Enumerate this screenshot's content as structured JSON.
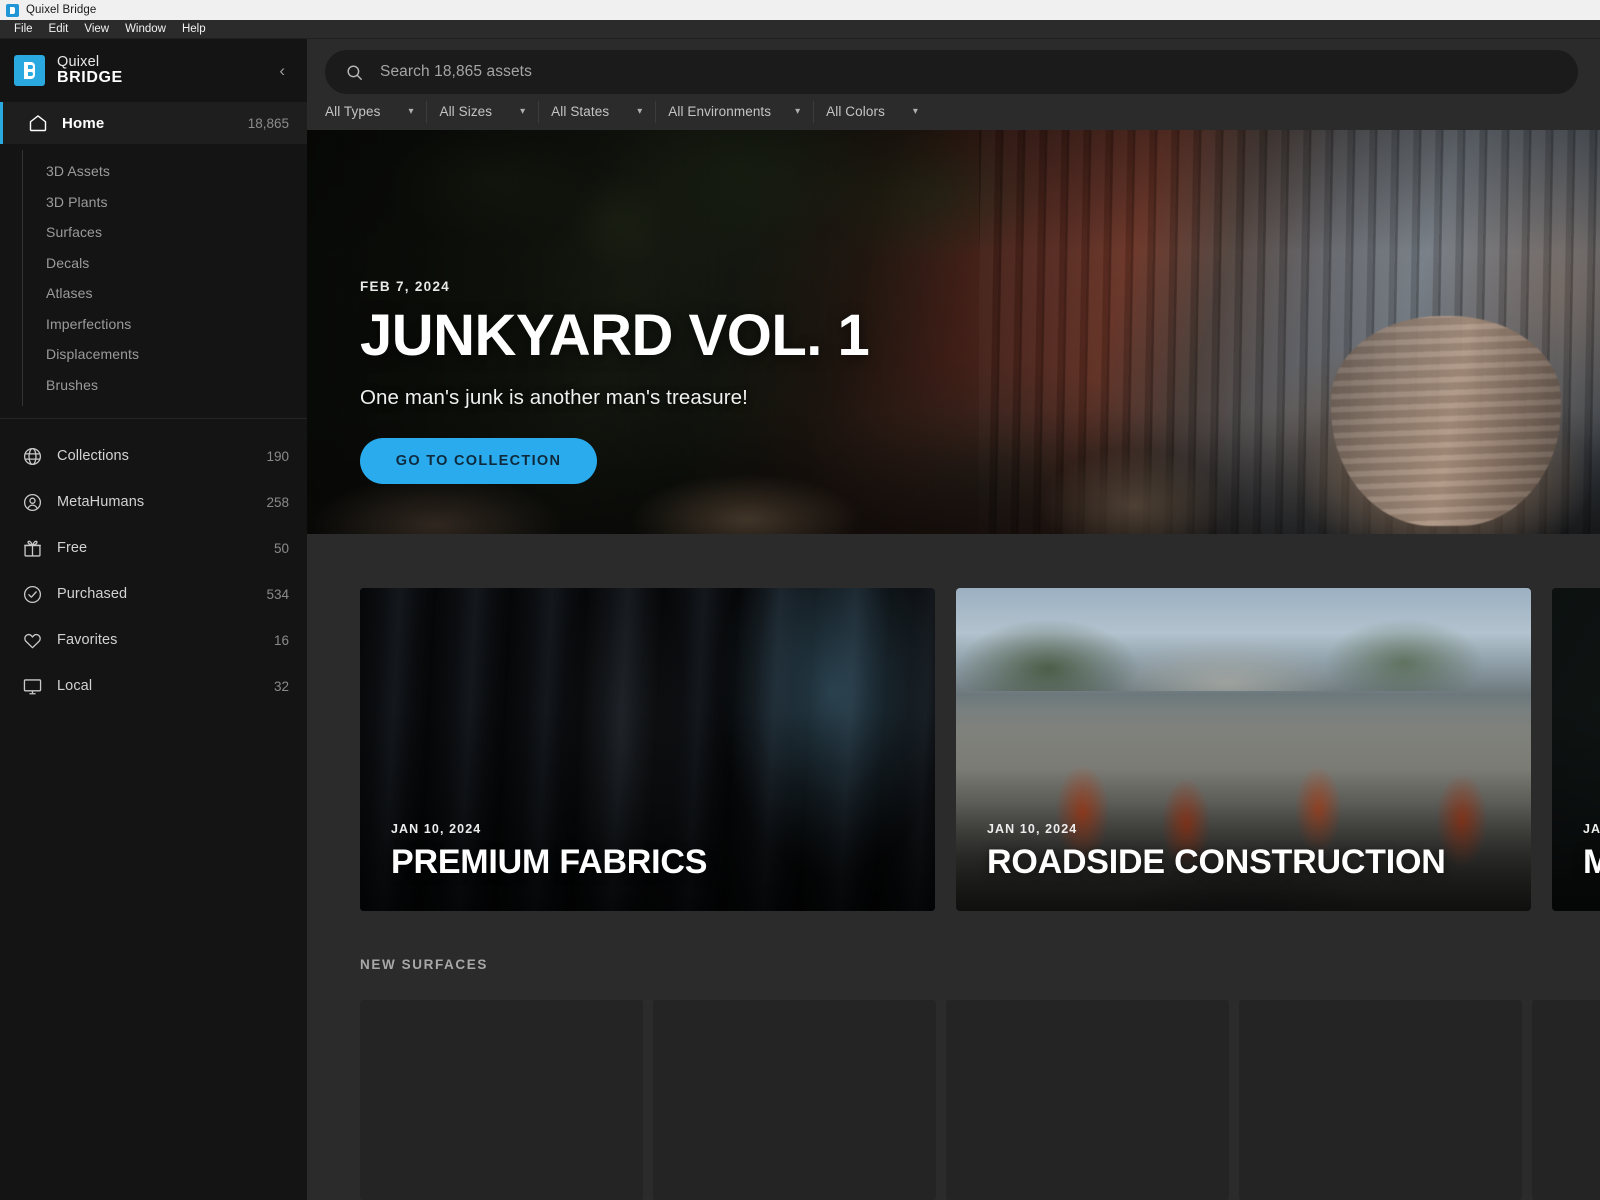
{
  "window": {
    "title": "Quixel Bridge",
    "icon": "bridge-app-icon"
  },
  "menubar": {
    "items": [
      {
        "label": "File"
      },
      {
        "label": "Edit"
      },
      {
        "label": "View"
      },
      {
        "label": "Window"
      },
      {
        "label": "Help"
      }
    ]
  },
  "sidebar": {
    "brand": {
      "line1": "Quixel",
      "line2": "BRIDGE",
      "logo_color": "#29a9e0"
    },
    "collapse_icon": "chevron-left-icon",
    "home": {
      "label": "Home",
      "count": "18,865",
      "icon": "home-icon",
      "accent_color": "#29a9e0"
    },
    "categories": [
      {
        "label": "3D Assets"
      },
      {
        "label": "3D Plants"
      },
      {
        "label": "Surfaces"
      },
      {
        "label": "Decals"
      },
      {
        "label": "Atlases"
      },
      {
        "label": "Imperfections"
      },
      {
        "label": "Displacements"
      },
      {
        "label": "Brushes"
      }
    ],
    "library": [
      {
        "label": "Collections",
        "count": "190",
        "icon": "globe-icon"
      },
      {
        "label": "MetaHumans",
        "count": "258",
        "icon": "person-circle-icon"
      },
      {
        "label": "Free",
        "count": "50",
        "icon": "gift-icon"
      },
      {
        "label": "Purchased",
        "count": "534",
        "icon": "check-circle-icon"
      },
      {
        "label": "Favorites",
        "count": "16",
        "icon": "heart-icon"
      },
      {
        "label": "Local",
        "count": "32",
        "icon": "monitor-icon"
      }
    ]
  },
  "search": {
    "placeholder": "Search 18,865 assets",
    "value": "",
    "icon": "search-icon"
  },
  "filters": [
    {
      "label": "All Types",
      "chevron": "chevron-down-icon"
    },
    {
      "label": "All Sizes",
      "chevron": "chevron-down-icon"
    },
    {
      "label": "All States",
      "chevron": "chevron-down-icon"
    },
    {
      "label": "All Environments",
      "chevron": "chevron-down-icon"
    },
    {
      "label": "All Colors",
      "chevron": "chevron-down-icon"
    }
  ],
  "hero": {
    "date": "FEB 7, 2024",
    "title": "JUNKYARD VOL. 1",
    "subtitle": "One man's junk is another man's treasure!",
    "cta_label": "GO TO COLLECTION",
    "cta_color": "#29abee"
  },
  "collections": [
    {
      "date": "JAN 10, 2024",
      "title": "PREMIUM FABRICS"
    },
    {
      "date": "JAN 10, 2024",
      "title": "ROADSIDE CONSTRUCTION"
    },
    {
      "date": "JA",
      "title": "M"
    }
  ],
  "sections": {
    "new_surfaces": "NEW SURFACES"
  }
}
